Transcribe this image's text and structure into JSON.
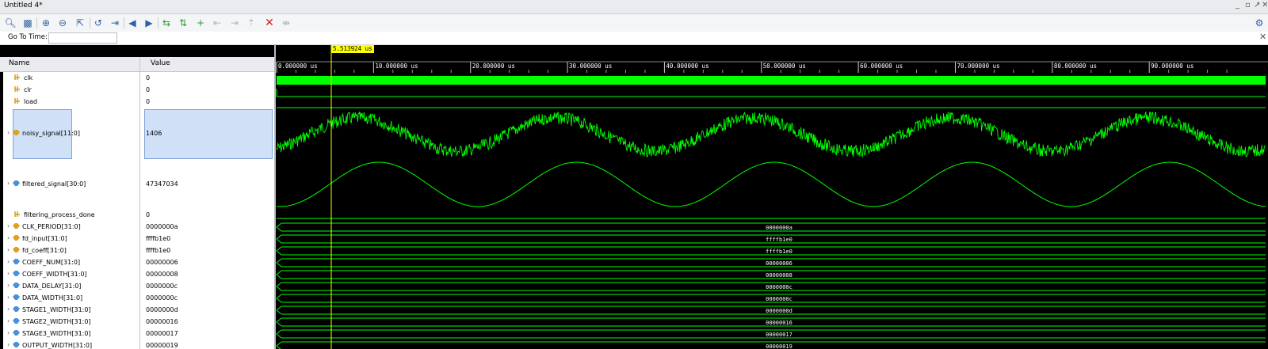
{
  "window": {
    "title": "Untitled 4*",
    "controls": [
      "_",
      "▫",
      "↗",
      "✕"
    ]
  },
  "toolbar": {
    "icons": [
      "search-icon",
      "save-icon",
      "zoom-in-icon",
      "zoom-out-icon",
      "zoom-fit-icon",
      "cursor-to-zero-icon",
      "go-to-time-zero-icon",
      "go-to-first-icon",
      "go-to-last-icon",
      "add-marker-icon",
      "previous-marker-icon",
      "next-marker-icon",
      "swap-cursors-icon",
      "previous-transition-icon",
      "next-transition-icon",
      "delete-marker-icon",
      "snap-icon",
      "settings-icon"
    ]
  },
  "goto": {
    "label": "Go To Time:",
    "value": "",
    "close": "✕"
  },
  "columns": {
    "name": "Name",
    "value": "Value"
  },
  "cursor": {
    "time": "5.513924 us"
  },
  "ruler": {
    "labels": [
      "0.000000 us",
      "10.000000 us",
      "20.000000 us",
      "30.000000 us",
      "40.000000 us",
      "50.000000 us",
      "60.000000 us",
      "70.000000 us",
      "80.000000 us",
      "90.000000 us"
    ]
  },
  "signals": [
    {
      "name": "clk",
      "value": "0",
      "kind": "bit"
    },
    {
      "name": "clr",
      "value": "0",
      "kind": "bit"
    },
    {
      "name": "load",
      "value": "0",
      "kind": "bit"
    },
    {
      "name": "noisy_signal[11:0]",
      "value": "1406",
      "kind": "bus-analog"
    },
    {
      "name": "filtered_signal[30:0]",
      "value": "47347034",
      "kind": "bus-analog"
    },
    {
      "name": "filtering_process_done",
      "value": "0",
      "kind": "bit"
    },
    {
      "name": "CLK_PERIOD[31:0]",
      "value": "0000000a",
      "kind": "param",
      "wave": "0000000a"
    },
    {
      "name": "fd_input[31:0]",
      "value": "ffffb1e0",
      "kind": "var",
      "wave": "ffffb1e0"
    },
    {
      "name": "fd_coeff[31:0]",
      "value": "ffffb1e0",
      "kind": "var",
      "wave": "ffffb1e0"
    },
    {
      "name": "COEFF_NUM[31:0]",
      "value": "00000006",
      "kind": "param",
      "wave": "00000006"
    },
    {
      "name": "COEFF_WIDTH[31:0]",
      "value": "00000008",
      "kind": "param",
      "wave": "00000008"
    },
    {
      "name": "DATA_DELAY[31:0]",
      "value": "0000000c",
      "kind": "param",
      "wave": "0000000c"
    },
    {
      "name": "DATA_WIDTH[31:0]",
      "value": "0000000c",
      "kind": "param",
      "wave": "0000000c"
    },
    {
      "name": "STAGE1_WIDTH[31:0]",
      "value": "0000000d",
      "kind": "param",
      "wave": "0000000d"
    },
    {
      "name": "STAGE2_WIDTH[31:0]",
      "value": "00000016",
      "kind": "param",
      "wave": "00000016"
    },
    {
      "name": "STAGE3_WIDTH[31:0]",
      "value": "00000017",
      "kind": "param",
      "wave": "00000017"
    },
    {
      "name": "OUTPUT_WIDTH[31:0]",
      "value": "00000019",
      "kind": "param",
      "wave": "00000019"
    }
  ],
  "colors": {
    "wave": "#00ff00",
    "cursor": "#ffff00",
    "selection": "#cfe0f7",
    "param_icon": "#4a90d9",
    "var_icon": "#e0a020",
    "bit_icon": "#d4a017"
  }
}
